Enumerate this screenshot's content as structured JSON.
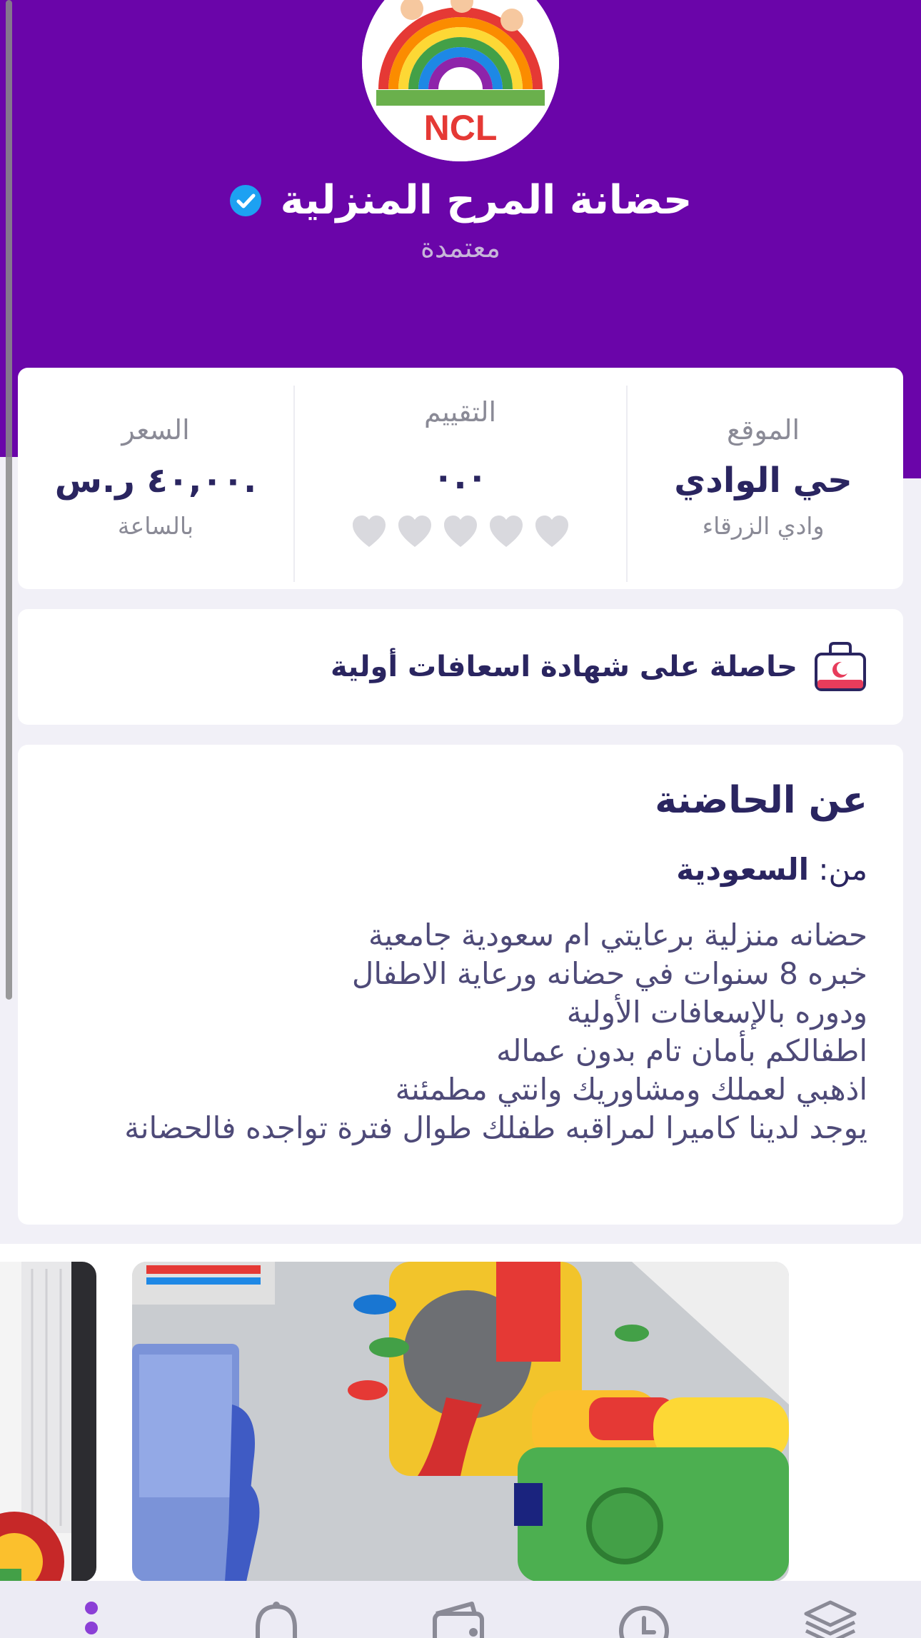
{
  "header": {
    "name": "حضانة  المرح المنزلية",
    "status": "معتمدة",
    "verified_icon": "verified-badge-icon",
    "colors": {
      "background": "#6a05a9",
      "verified": "#1da1f2"
    }
  },
  "stats": {
    "location": {
      "label": "الموقع",
      "value": "حي الوادي",
      "sub": "وادي الزرقاء"
    },
    "rating": {
      "label": "التقييم",
      "value": "٠.٠",
      "hearts_filled": 0,
      "hearts_total": 5
    },
    "price": {
      "label": "السعر",
      "value": "٤٠,٠٠ ر.س.",
      "sub": "بالساعة"
    }
  },
  "certificate": {
    "text": "حاصلة على شهادة اسعافات أولية",
    "icon": "first-aid-kit-icon"
  },
  "about": {
    "title": "عن الحاضنة",
    "from_label": "من:",
    "from_value": "السعودية",
    "lines": [
      "حضانه منزلية برعايتي ام سعودية جامعية",
      "خبره 8 سنوات في حضانه ورعاية  الاطفال",
      "ودوره بالإسعافات الأولية",
      "اطفالكم بأمان تام بدون عماله",
      "اذهبي لعملك ومشاوريك وانتي مطمئنة",
      "يوجد لدينا كاميرا لمراقبه طفلك طوال فترة تواجده فالحضانة"
    ]
  },
  "gallery": {
    "images": [
      "playroom-photo",
      "playroom-photo-partial"
    ]
  },
  "tabbar": {
    "icons": [
      "more-dots-icon",
      "bell-icon",
      "wallet-icon",
      "clock-icon",
      "layers-icon"
    ]
  }
}
